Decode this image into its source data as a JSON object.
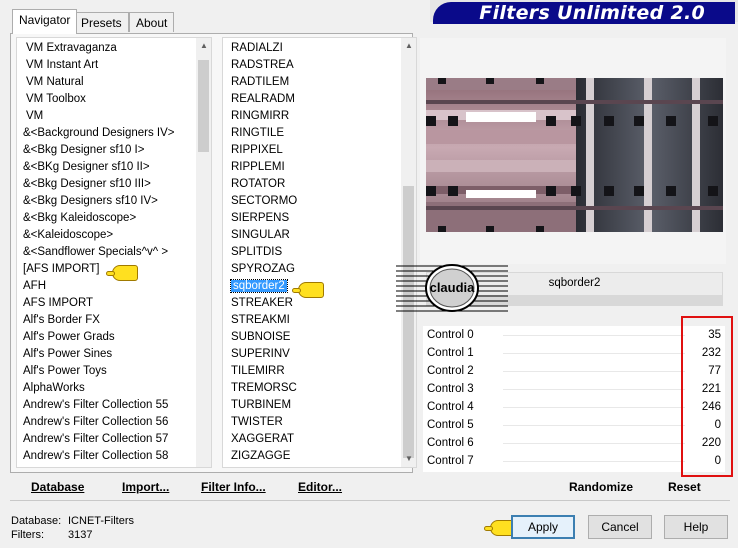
{
  "title": "Filters Unlimited 2.0",
  "tabs": [
    "Navigator",
    "Presets",
    "About"
  ],
  "categories": [
    "VM Extravaganza",
    "VM Instant Art",
    "VM Natural",
    "VM Toolbox",
    "VM",
    "&<Background Designers IV>",
    "&<Bkg Designer sf10 I>",
    "&<BKg Designer sf10 II>",
    "&<Bkg Designer sf10 III>",
    "&<Bkg Designers sf10 IV>",
    "&<Bkg Kaleidoscope>",
    "&<Kaleidoscope>",
    "&<Sandflower Specials^v^ >",
    "[AFS IMPORT]",
    "AFH",
    "AFS IMPORT",
    "Alf's Border FX",
    "Alf's Power Grads",
    "Alf's Power Sines",
    "Alf's Power Toys",
    "AlphaWorks",
    "Andrew's Filter Collection 55",
    "Andrew's Filter Collection 56",
    "Andrew's Filter Collection 57",
    "Andrew's Filter Collection 58"
  ],
  "filters": [
    "RADIALZI",
    "RADSTREA",
    "RADTILEM",
    "REALRADM",
    "RINGMIRR",
    "RINGTILE",
    "RIPPIXEL",
    "RIPPLEMI",
    "ROTATOR",
    "SECTORMO",
    "SIERPENS",
    "SINGULAR",
    "SPLITDIS",
    "SPYROZAG",
    "sqborder2",
    "STREAKER",
    "STREAKMI",
    "SUBNOISE",
    "SUPERINV",
    "TILEMIRR",
    "TREMORSC",
    "TURBINEM",
    "TWISTER",
    "XAGGERAT",
    "ZIGZAGGE"
  ],
  "selected_filter": "sqborder2",
  "filter_name_display": "sqborder2",
  "watermark": "claudia",
  "controls": [
    {
      "label": "Control 0",
      "value": "35"
    },
    {
      "label": "Control 1",
      "value": "232"
    },
    {
      "label": "Control 2",
      "value": "77"
    },
    {
      "label": "Control 3",
      "value": "221"
    },
    {
      "label": "Control 4",
      "value": "246"
    },
    {
      "label": "Control 5",
      "value": "0"
    },
    {
      "label": "Control 6",
      "value": "220"
    },
    {
      "label": "Control 7",
      "value": "0"
    }
  ],
  "toolbar": {
    "database": "Database",
    "import": "Import...",
    "filter_info": "Filter Info...",
    "editor": "Editor...",
    "randomize": "Randomize",
    "reset": "Reset"
  },
  "status": {
    "database_label": "Database:",
    "database_value": "ICNET-Filters",
    "filters_label": "Filters:",
    "filters_value": "3137"
  },
  "buttons": {
    "apply": "Apply",
    "cancel": "Cancel",
    "help": "Help"
  },
  "colors": {
    "highlight_box": "#e01010",
    "selection": "#3399ff",
    "banner": "#0a0a8a"
  }
}
